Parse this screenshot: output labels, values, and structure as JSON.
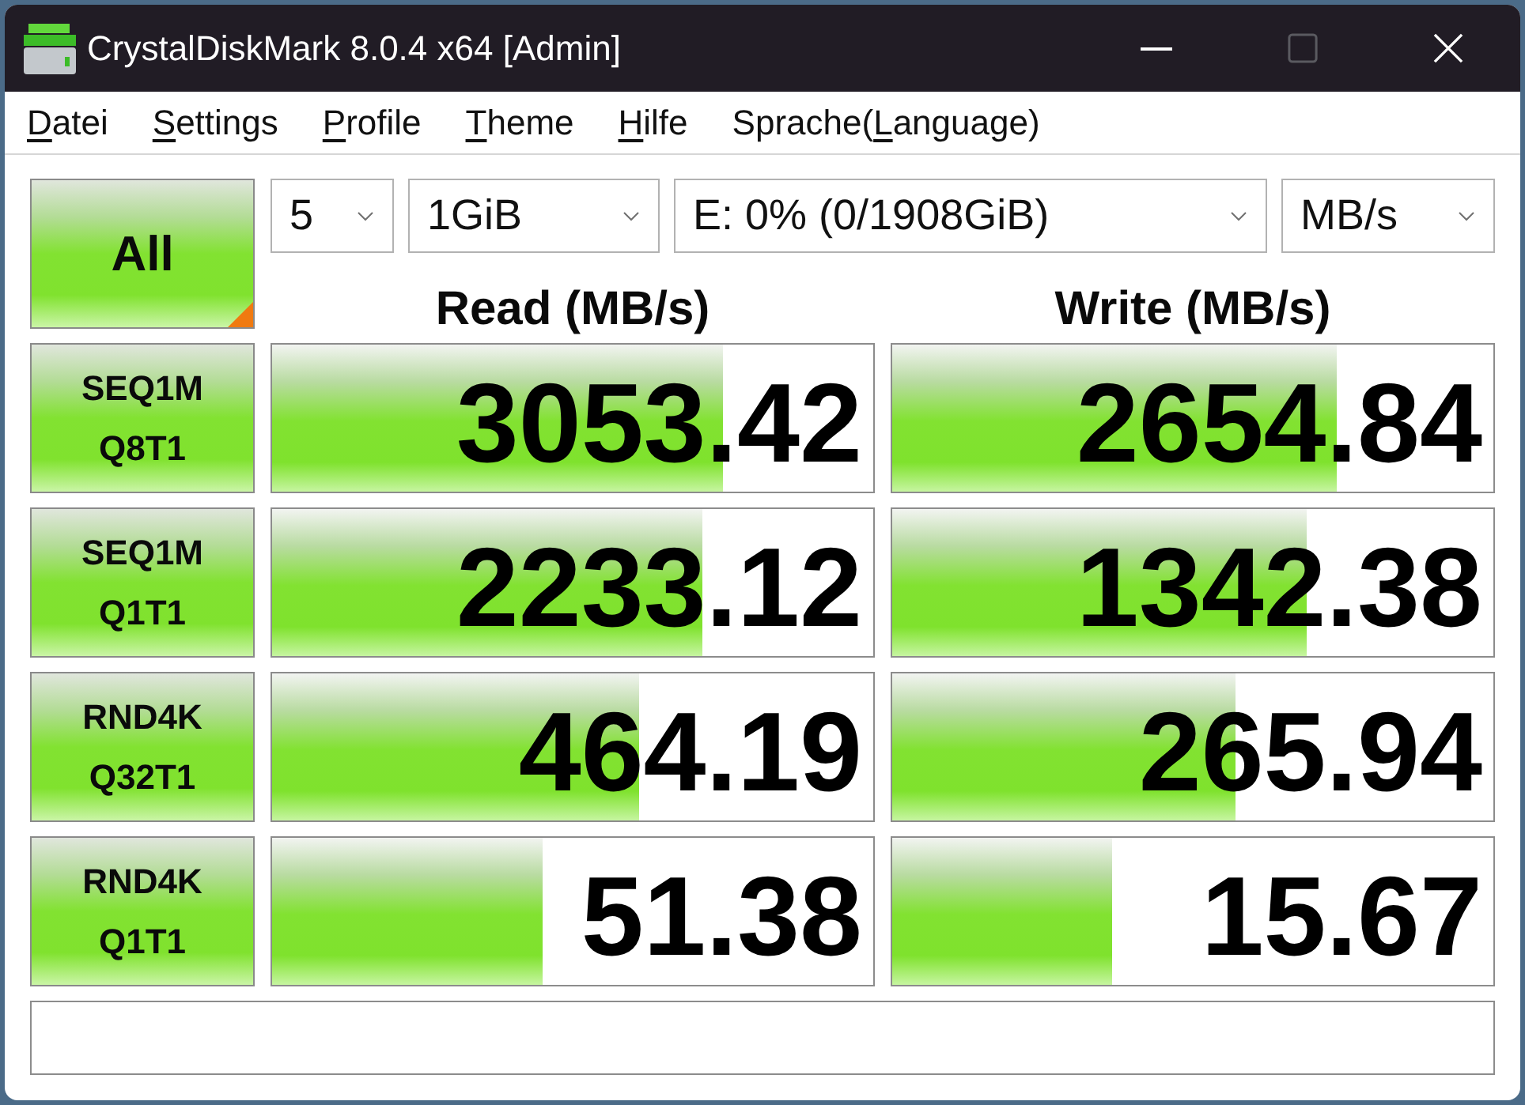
{
  "window": {
    "title": "CrystalDiskMark 8.0.4 x64 [Admin]",
    "controls": [
      {
        "kind": "minimize",
        "disabled": false
      },
      {
        "kind": "maximize",
        "disabled": true
      },
      {
        "kind": "close",
        "disabled": false
      }
    ]
  },
  "menu": [
    {
      "access_key": "D",
      "rest": "atei"
    },
    {
      "access_key": "S",
      "rest": "ettings"
    },
    {
      "access_key": "P",
      "rest": "rofile"
    },
    {
      "access_key": "T",
      "rest": "heme"
    },
    {
      "access_key": "H",
      "rest": "ilfe"
    },
    {
      "before": "Sprache(",
      "access_key": "L",
      "rest": "anguage)"
    }
  ],
  "toolbar": {
    "all_button": "All",
    "dropdowns": [
      {
        "value": "5"
      },
      {
        "value": "1GiB"
      },
      {
        "value": "E: 0% (0/1908GiB)"
      },
      {
        "value": "MB/s"
      }
    ]
  },
  "columns": [
    "Read (MB/s)",
    "Write (MB/s)"
  ],
  "tests": [
    {
      "name": "SEQ1M",
      "params": "Q8T1",
      "read": {
        "value": "3053.42",
        "level": 0.75
      },
      "write": {
        "value": "2654.84",
        "level": 0.74
      }
    },
    {
      "name": "SEQ1M",
      "params": "Q1T1",
      "read": {
        "value": "2233.12",
        "level": 0.715
      },
      "write": {
        "value": "1342.38",
        "level": 0.69
      }
    },
    {
      "name": "RND4K",
      "params": "Q32T1",
      "read": {
        "value": "464.19",
        "level": 0.61
      },
      "write": {
        "value": "265.94",
        "level": 0.57
      }
    },
    {
      "name": "RND4K",
      "params": "Q1T1",
      "read": {
        "value": "51.38",
        "level": 0.45
      },
      "write": {
        "value": "15.67",
        "level": 0.365
      }
    }
  ]
}
